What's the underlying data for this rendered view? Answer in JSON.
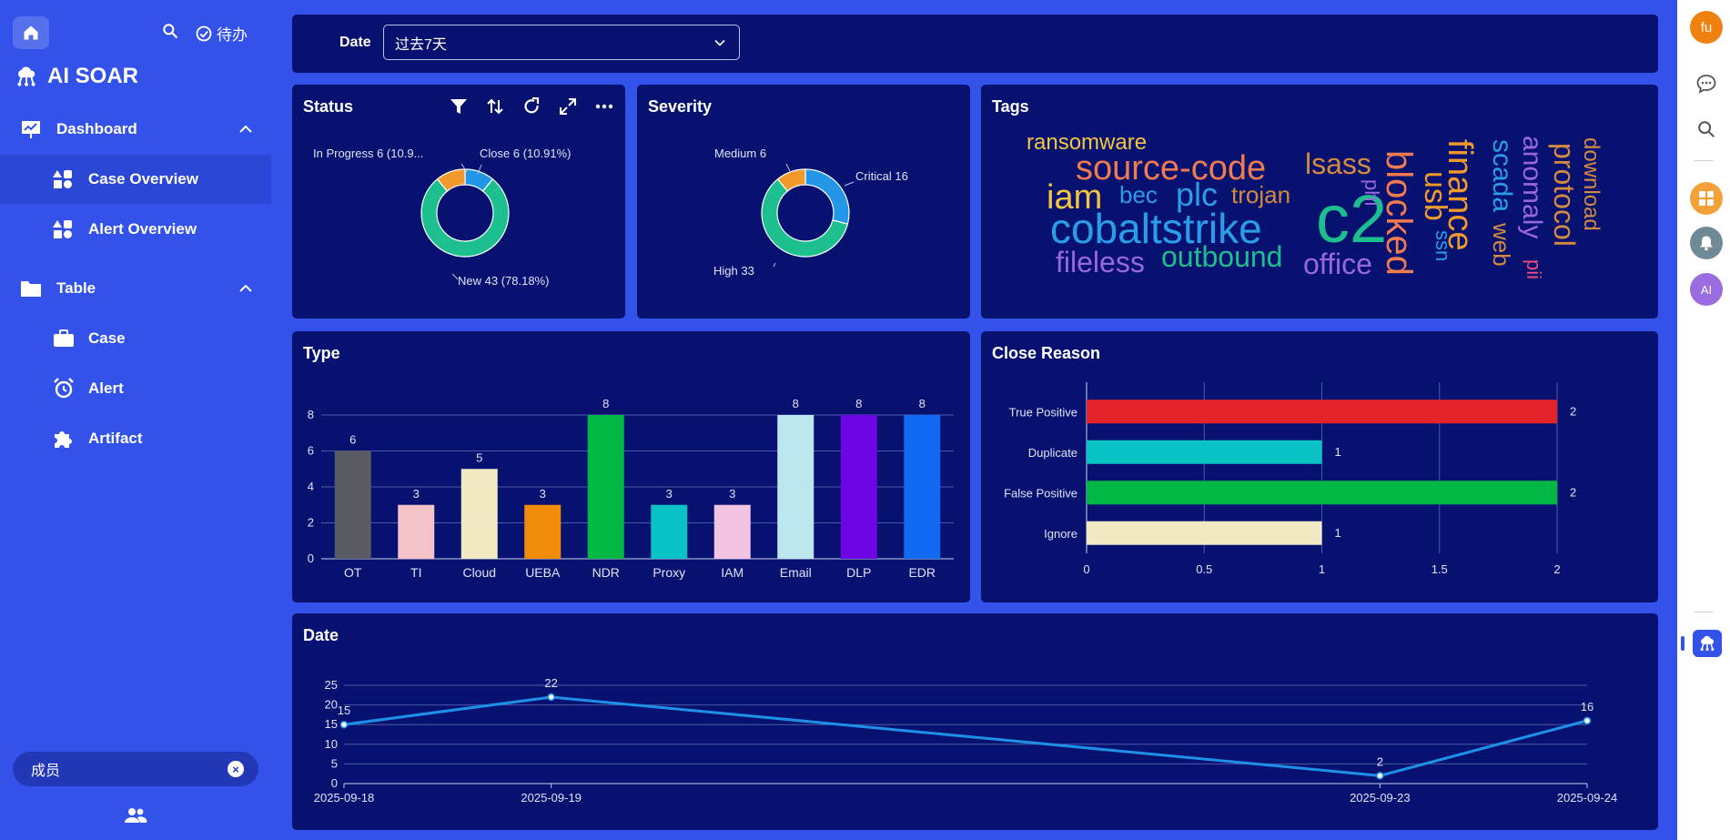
{
  "sidebar": {
    "todo_label": "待办",
    "brand": "AI SOAR",
    "groups": [
      {
        "label": "Dashboard",
        "items": [
          {
            "label": "Case Overview"
          },
          {
            "label": "Alert Overview"
          }
        ]
      },
      {
        "label": "Table",
        "items": [
          {
            "label": "Case"
          },
          {
            "label": "Alert"
          },
          {
            "label": "Artifact"
          }
        ]
      }
    ],
    "member_label": "成员"
  },
  "filter": {
    "date_label": "Date",
    "date_value": "过去7天"
  },
  "panels": {
    "status": "Status",
    "severity": "Severity",
    "tags": "Tags",
    "type": "Type",
    "close_reason": "Close Reason",
    "date": "Date"
  },
  "rail": {
    "avatar_text": "fu",
    "ai_text": "AI"
  },
  "colors": {
    "accent": "#3352ea",
    "panel": "#071270"
  },
  "chart_data": [
    {
      "id": "status",
      "type": "pie",
      "title": "Status",
      "slices": [
        {
          "label": "New",
          "value": 43,
          "percent": "78.18%",
          "color": "#1dbf8e"
        },
        {
          "label": "In Progress",
          "value": 6,
          "percent": "10.9...",
          "color": "#f19a2b"
        },
        {
          "label": "Close",
          "value": 6,
          "percent": "10.91%",
          "color": "#2496e8"
        }
      ],
      "slice_labels": [
        "In Progress  6 (10.9...",
        "Close  6 (10.91%)",
        "New  43 (78.18%)"
      ]
    },
    {
      "id": "severity",
      "type": "pie",
      "title": "Severity",
      "slices": [
        {
          "label": "Critical",
          "value": 16,
          "color": "#2496e8"
        },
        {
          "label": "High",
          "value": 33,
          "color": "#1dbf8e"
        },
        {
          "label": "Medium",
          "value": 6,
          "color": "#f19a2b"
        }
      ],
      "slice_labels": [
        "Critical  16",
        "High  33",
        "Medium  6"
      ]
    },
    {
      "id": "tags",
      "type": "wordcloud",
      "title": "Tags",
      "words": [
        "ransomware",
        "source-code",
        "lsass",
        "iam",
        "bec",
        "plc",
        "trojan",
        "cobaltstrike",
        "c2",
        "fileless",
        "outbound",
        "office",
        "phi",
        "blocked",
        "usb",
        "ssn",
        "finance",
        "scada",
        "web",
        "anomaly",
        "pii",
        "protocol",
        "download"
      ]
    },
    {
      "id": "type",
      "type": "bar",
      "title": "Type",
      "categories": [
        "OT",
        "TI",
        "Cloud",
        "UEBA",
        "NDR",
        "Proxy",
        "IAM",
        "Email",
        "DLP",
        "EDR"
      ],
      "values": [
        6,
        3,
        5,
        3,
        8,
        3,
        3,
        8,
        8,
        8
      ],
      "colors": [
        "#5a5a62",
        "#f4c3c9",
        "#f1e9c3",
        "#f18c0a",
        "#02b844",
        "#08c3c5",
        "#f2c3e3",
        "#bde7ee",
        "#6e06e3",
        "#136af2"
      ],
      "yticks": [
        0,
        2,
        4,
        6,
        8
      ],
      "ylim": [
        0,
        8
      ]
    },
    {
      "id": "close_reason",
      "type": "bar",
      "orientation": "horizontal",
      "title": "Close Reason",
      "categories": [
        "True Positive",
        "Duplicate",
        "False Positive",
        "Ignore"
      ],
      "values": [
        2,
        1,
        2,
        1
      ],
      "colors": [
        "#e5232b",
        "#08c3c5",
        "#02b844",
        "#f1e9c3"
      ],
      "xticks": [
        "0",
        "0.5",
        "1",
        "1.5",
        "2"
      ],
      "xlim": [
        0,
        2
      ]
    },
    {
      "id": "date",
      "type": "line",
      "title": "Date",
      "x": [
        "2025-09-18",
        "2025-09-19",
        "2025-09-23",
        "2025-09-24"
      ],
      "values": [
        15,
        22,
        2,
        16
      ],
      "yticks": [
        0,
        5,
        10,
        15,
        20,
        25
      ],
      "ylim": [
        0,
        25
      ],
      "color": "#1e90e8"
    }
  ]
}
